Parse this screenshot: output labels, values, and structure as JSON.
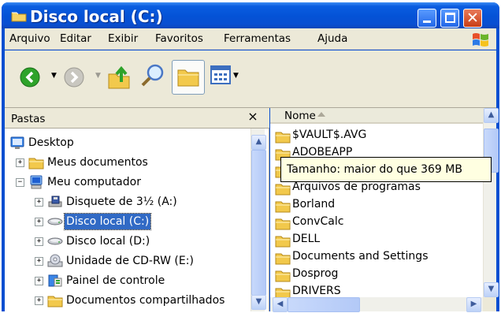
{
  "window": {
    "title": "Disco local (C:)"
  },
  "menu": [
    "Arquivo",
    "Editar",
    "Exibir",
    "Favoritos",
    "Ferramentas",
    "Ajuda"
  ],
  "toolbar": {
    "back_icon": "back-arrow-icon",
    "forward_icon": "forward-arrow-icon",
    "up_icon": "folder-up-icon",
    "search_icon": "magnifier-icon",
    "folders_icon": "folders-icon",
    "views_icon": "views-icon"
  },
  "left_pane": {
    "title": "Pastas",
    "close_glyph": "×",
    "tree": [
      {
        "label": "Desktop",
        "icon": "desktop-icon",
        "expander": "",
        "indent": 0
      },
      {
        "label": "Meus documentos",
        "icon": "folder-icon",
        "expander": "+",
        "indent": 1
      },
      {
        "label": "Meu computador",
        "icon": "computer-icon",
        "expander": "−",
        "indent": 1
      },
      {
        "label": "Disquete de 3½ (A:)",
        "icon": "floppy-drive-icon",
        "expander": "+",
        "indent": 2
      },
      {
        "label": "Disco local (C:)",
        "icon": "hard-drive-icon",
        "expander": "+",
        "indent": 2,
        "selected": true
      },
      {
        "label": "Disco local (D:)",
        "icon": "hard-drive-icon",
        "expander": "+",
        "indent": 2
      },
      {
        "label": "Unidade de CD-RW (E:)",
        "icon": "cd-drive-icon",
        "expander": "+",
        "indent": 2
      },
      {
        "label": "Painel de controle",
        "icon": "control-panel-icon",
        "expander": "+",
        "indent": 2
      },
      {
        "label": "Documentos compartilhados",
        "icon": "folder-icon",
        "expander": "+",
        "indent": 2
      }
    ]
  },
  "right_pane": {
    "column_header": "Nome",
    "files": [
      "$VAULT$.AVG",
      "ADOBEAPP",
      "",
      "Arquivos de programas",
      "Borland",
      "ConvCalc",
      "DELL",
      "Documents and Settings",
      "Dosprog",
      "DRIVERS"
    ]
  },
  "tooltip": {
    "text": "Tamanho: maior do que 369 MB"
  },
  "colors": {
    "title_bar": "#0a4fd1",
    "selection": "#316ac5",
    "folder": "#f2c94c",
    "chrome": "#ece9d8"
  }
}
